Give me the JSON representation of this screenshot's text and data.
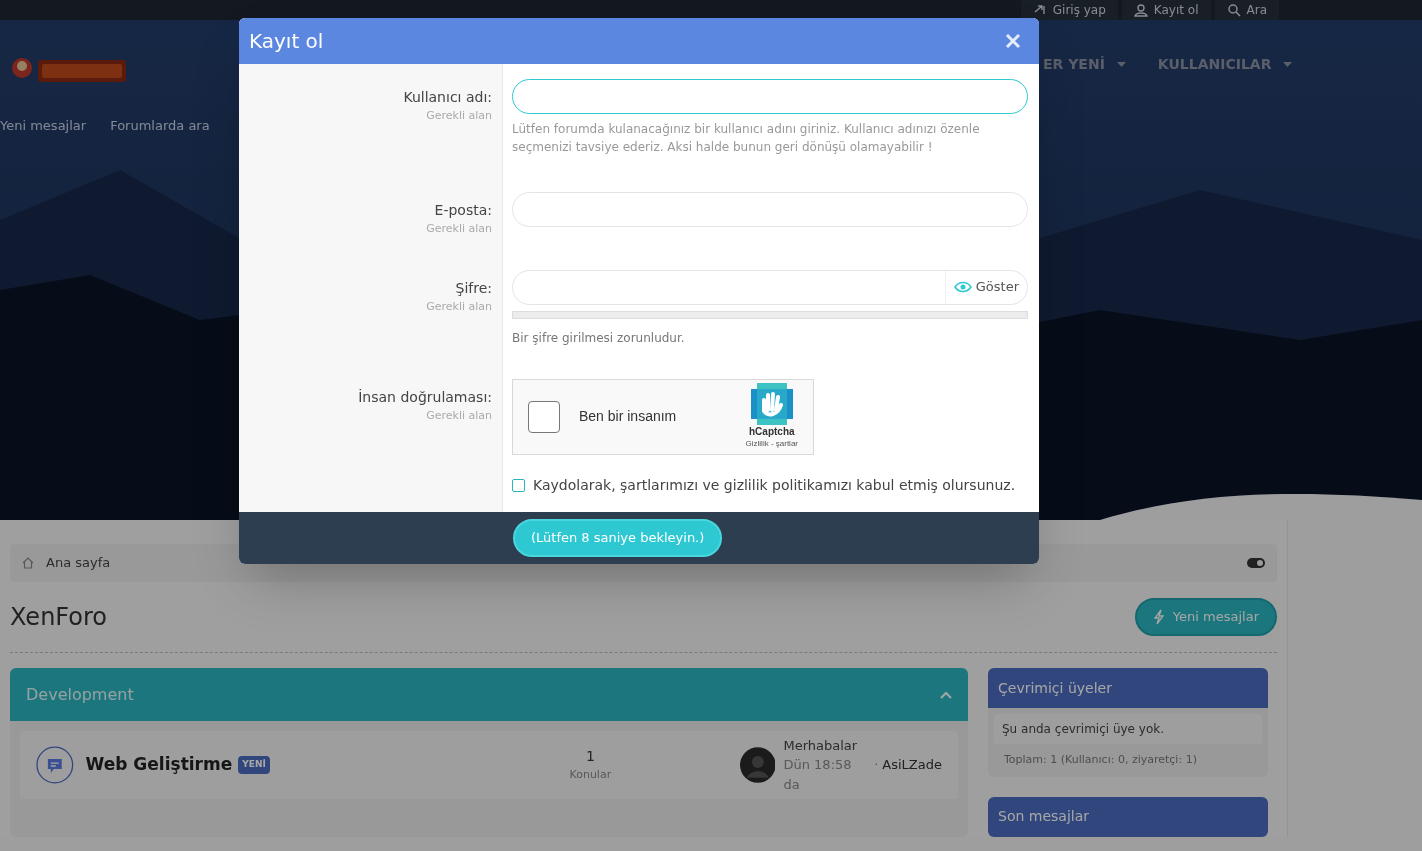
{
  "top_bar": {
    "items": [
      {
        "label": "Giriş yap"
      },
      {
        "label": "Kayıt ol"
      },
      {
        "label": "Ara"
      }
    ]
  },
  "header": {
    "nav": [
      {
        "label": "ER YENİ"
      },
      {
        "label": "KULLANICILAR"
      }
    ],
    "subnav": [
      "Yeni mesajlar",
      "Forumlarda ara"
    ]
  },
  "breadcrumb": "Ana sayfa",
  "page_title": "XenForo",
  "new_posts_button": "Yeni mesajlar",
  "category": {
    "title": "Development",
    "expanded": true,
    "forums": [
      {
        "title": "Web Geliştirme",
        "badge": "YENİ",
        "count": "1",
        "count_label": "Konular",
        "last_title": "Merhabalar",
        "last_time": "Dün 18:58 da",
        "separator": "·",
        "last_user": "AsiLZade"
      }
    ]
  },
  "sidebar": [
    {
      "title": "Çevrimiçi üyeler",
      "text": "Şu anda çevrimiçi üye yok.",
      "footer": "Toplam: 1 (Kullanıcı: 0, ziyaretçi: 1)"
    },
    {
      "title": "Son mesajlar"
    }
  ],
  "modal": {
    "title": "Kayıt ol",
    "fields": [
      {
        "kind": "text",
        "label": "Kullanıcı adı:",
        "hint": "Gerekli alan",
        "focused": true,
        "help": "Lütfen forumda kulanacağınız bir kullanıcı adını giriniz. Kullanıcı adınızı özenle seçmenizi tavsiye ederiz. Aksi halde bunun geri dönüşü olamayabilir !"
      },
      {
        "kind": "text",
        "label": "E-posta:",
        "hint": "Gerekli alan",
        "focused": false
      },
      {
        "kind": "password",
        "label": "Şifre:",
        "hint": "Gerekli alan",
        "focused": false,
        "show_label": "Göster",
        "help": "Bir şifre girilmesi zorunludur."
      },
      {
        "kind": "captcha",
        "label": "İnsan doğrulaması:",
        "hint": "Gerekli alan",
        "checked": false,
        "captcha_label": "Ben bir insanım",
        "brand": "hCaptcha",
        "links": "Gizlilik - şartlar"
      }
    ],
    "agreement": {
      "text": "Kaydolarak, şartlarımızı ve gizlilik politikamızı kabul etmiş olursunuz.",
      "checked": false
    },
    "submit": "(Lütfen 8 saniye bekleyin.)"
  }
}
